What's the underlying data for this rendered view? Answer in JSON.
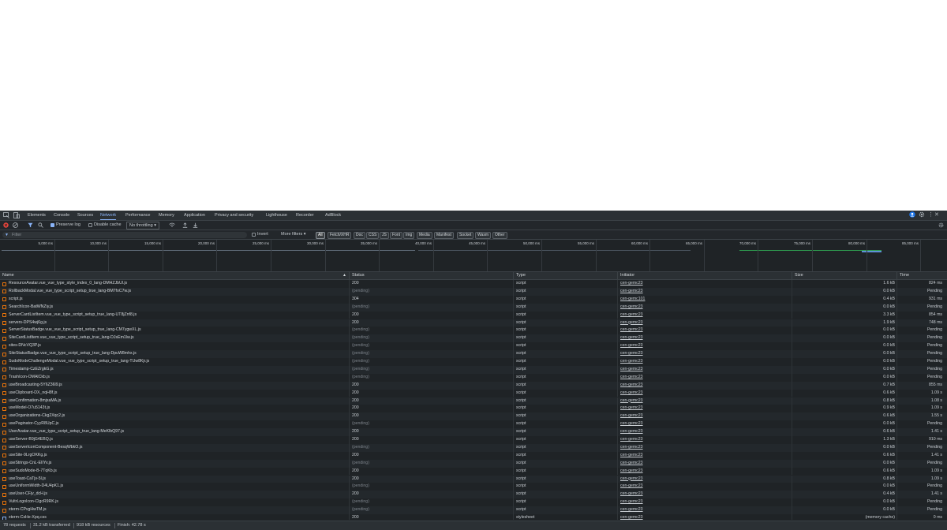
{
  "devtools": {
    "tabs": [
      "Elements",
      "Console",
      "Sources",
      "Network",
      "Performance",
      "Memory",
      "Application",
      "Privacy and security",
      "Lighthouse",
      "Recorder",
      "AdBlock"
    ],
    "active_tab": "Network",
    "right_icons": [
      "profile-icon",
      "gear-icon",
      "more-vert-icon",
      "close-icon"
    ]
  },
  "toolbar": {
    "preserve_log_label": "Preserve log",
    "preserve_log_checked": true,
    "disable_cache_label": "Disable cache",
    "disable_cache_checked": false,
    "throttling_value": "No throttling"
  },
  "filterbar": {
    "filter_placeholder": "Filter",
    "invert_label": "Invert",
    "more_filters_label": "More filters ▾",
    "chips": [
      "All",
      "Fetch/XHR",
      "Doc",
      "CSS",
      "JS",
      "Font",
      "Img",
      "Media",
      "Manifest",
      "Socket",
      "Wasm",
      "Other"
    ],
    "active_chip": "All"
  },
  "overview": {
    "ticks": [
      "5,000 ms",
      "10,000 ms",
      "15,000 ms",
      "20,000 ms",
      "25,000 ms",
      "30,000 ms",
      "35,000 ms",
      "40,000 ms",
      "45,000 ms",
      "50,000 ms",
      "55,000 ms",
      "60,000 ms",
      "65,000 ms",
      "70,000 ms",
      "75,000 ms",
      "80,000 ms",
      "85,000 ms"
    ]
  },
  "table": {
    "columns": {
      "name": "Name",
      "status": "Status",
      "type": "Type",
      "initiator": "Initiator",
      "size": "Size",
      "time": "Time"
    },
    "rows": [
      {
        "name": "ResourceAvatar.vue_vue_type_style_index_0_lang-DMHZJbUl.js",
        "status": "200",
        "type": "script",
        "initiator": "cen-gemc23",
        "size": "1.6 kB",
        "time": "824 ms",
        "kind": "js"
      },
      {
        "name": "RollbackModal.vue_vue_type_script_setup_true_lang-BM7foC7w.js",
        "status": "(pending)",
        "type": "script",
        "initiator": "cen-gemc23",
        "size": "0.0 kB",
        "time": "Pending",
        "kind": "js"
      },
      {
        "name": "script.js",
        "status": "304",
        "type": "script",
        "initiator": "cen-gemc101",
        "size": "0.4 kB",
        "time": "931 ms",
        "kind": "js"
      },
      {
        "name": "SearchIcon-BatWNZiy.js",
        "status": "(pending)",
        "type": "script",
        "initiator": "cen-gemc23",
        "size": "0.0 kB",
        "time": "Pending",
        "kind": "js"
      },
      {
        "name": "ServerCardListItem.vue_vue_type_script_setup_true_lang-UT8jZnf8.js",
        "status": "200",
        "type": "script",
        "initiator": "cen-gemc23",
        "size": "3.3 kB",
        "time": "854 ms",
        "kind": "js"
      },
      {
        "name": "servers-DPS4wj6g.js",
        "status": "200",
        "type": "script",
        "initiator": "cen-gemc23",
        "size": "1.9 kB",
        "time": "748 ms",
        "kind": "js"
      },
      {
        "name": "ServerStatusBadge.vue_vue_type_script_setup_true_lang-CM7ygwXL.js",
        "status": "(pending)",
        "type": "script",
        "initiator": "cen-gemc23",
        "size": "0.0 kB",
        "time": "Pending",
        "kind": "js"
      },
      {
        "name": "SiteCardListItem.vue_vue_type_script_setup_true_lang-DJsEm1lw.js",
        "status": "(pending)",
        "type": "script",
        "initiator": "cen-gemc23",
        "size": "0.0 kB",
        "time": "Pending",
        "kind": "js"
      },
      {
        "name": "sites-DNcVQ3P.js",
        "status": "(pending)",
        "type": "script",
        "initiator": "cen-gemc23",
        "size": "0.0 kB",
        "time": "Pending",
        "kind": "js"
      },
      {
        "name": "SiteStatusBadge.vue_vue_type_script_setup_true_lang-DpuW8mhx.js",
        "status": "(pending)",
        "type": "script",
        "initiator": "cen-gemc23",
        "size": "0.0 kB",
        "time": "Pending",
        "kind": "js"
      },
      {
        "name": "SudoModeChallengeModal.vue_vue_type_script_setup_true_lang-TUw8Kjr.js",
        "status": "(pending)",
        "type": "script",
        "initiator": "cen-gemc23",
        "size": "0.0 kB",
        "time": "Pending",
        "kind": "js"
      },
      {
        "name": "Timestamp-CzEZrgkG.js",
        "status": "(pending)",
        "type": "script",
        "initiator": "cen-gemc23",
        "size": "0.0 kB",
        "time": "Pending",
        "kind": "js"
      },
      {
        "name": "TrashIcon-OMAlCkb.js",
        "status": "(pending)",
        "type": "script",
        "initiator": "cen-gemc23",
        "size": "0.0 kB",
        "time": "Pending",
        "kind": "js"
      },
      {
        "name": "useBroadcasting-5Y6Z36l9.js",
        "status": "200",
        "type": "script",
        "initiator": "cen-gemc23",
        "size": "0.7 kB",
        "time": "855 ms",
        "kind": "js"
      },
      {
        "name": "useClipboard-DX_nqH8f.js",
        "status": "200",
        "type": "script",
        "initiator": "cen-gemc23",
        "size": "0.6 kB",
        "time": "1.09 s",
        "kind": "js"
      },
      {
        "name": "useConfirmation-8mjxaMA.js",
        "status": "200",
        "type": "script",
        "initiator": "cen-gemc23",
        "size": "0.8 kB",
        "time": "1.08 s",
        "kind": "js"
      },
      {
        "name": "useModel-O7u5143t.js",
        "status": "200",
        "type": "script",
        "initiator": "cen-gemc23",
        "size": "0.9 kB",
        "time": "1.09 s",
        "kind": "js"
      },
      {
        "name": "useOrganizations-Ckg2Xqc2.js",
        "status": "200",
        "type": "script",
        "initiator": "cen-gemc23",
        "size": "0.6 kB",
        "time": "1.55 s",
        "kind": "js"
      },
      {
        "name": "usePaginator-CyyR8UpC.js",
        "status": "(pending)",
        "type": "script",
        "initiator": "cen-gemc23",
        "size": "0.0 kB",
        "time": "Pending",
        "kind": "js"
      },
      {
        "name": "UserAvatar.vue_vue_type_script_setup_true_lang-MeKlbQ97.js",
        "status": "200",
        "type": "script",
        "initiator": "cen-gemc23",
        "size": "0.6 kB",
        "time": "1.41 s",
        "kind": "js"
      },
      {
        "name": "useServer-B9jG4EBQ.js",
        "status": "200",
        "type": "script",
        "initiator": "cen-gemc23",
        "size": "1.3 kB",
        "time": "910 ms",
        "kind": "js"
      },
      {
        "name": "useServerIconComponent-BesqWbkO.js",
        "status": "(pending)",
        "type": "script",
        "initiator": "cen-gemc23",
        "size": "0.0 kB",
        "time": "Pending",
        "kind": "js"
      },
      {
        "name": "useSite-9LrgOKKg.js",
        "status": "200",
        "type": "script",
        "initiator": "cen-gemc23",
        "size": "0.6 kB",
        "time": "1.41 s",
        "kind": "js"
      },
      {
        "name": "useStrings-CnL-EIIYv.js",
        "status": "(pending)",
        "type": "script",
        "initiator": "cen-gemc23",
        "size": "0.0 kB",
        "time": "Pending",
        "kind": "js"
      },
      {
        "name": "useSudoMode-B-7TqKb.js",
        "status": "200",
        "type": "script",
        "initiator": "cen-gemc23",
        "size": "0.6 kB",
        "time": "1.09 s",
        "kind": "js"
      },
      {
        "name": "useToast-CaTjv-5l.js",
        "status": "200",
        "type": "script",
        "initiator": "cen-gemc23",
        "size": "0.8 kB",
        "time": "1.09 s",
        "kind": "js"
      },
      {
        "name": "useUniformWidth-D4U4pK1.js",
        "status": "(pending)",
        "type": "script",
        "initiator": "cen-gemc23",
        "size": "0.0 kB",
        "time": "Pending",
        "kind": "js"
      },
      {
        "name": "useUser-CFjv_dcH.js",
        "status": "200",
        "type": "script",
        "initiator": "cen-gemc23",
        "size": "0.4 kB",
        "time": "1.41 s",
        "kind": "js"
      },
      {
        "name": "VultrLogoIcon-ClgcR9RK.js",
        "status": "(pending)",
        "type": "script",
        "initiator": "cen-gemc23",
        "size": "0.0 kB",
        "time": "Pending",
        "kind": "js"
      },
      {
        "name": "xterm-CPvgHwTM.js",
        "status": "(pending)",
        "type": "script",
        "initiator": "cen-gemc23",
        "size": "0.0 kB",
        "time": "Pending",
        "kind": "js"
      },
      {
        "name": "xterm-CsHe-Xpq.css",
        "status": "200",
        "type": "stylesheet",
        "initiator": "cen-gemc23",
        "size": "(memory cache)",
        "time": "0 ms",
        "kind": "css"
      }
    ]
  },
  "statusbar": {
    "requests": "78 requests",
    "transferred": "31.2 kB transferred",
    "resources": "918 kB resources",
    "finish": "Finish: 42.78 s"
  },
  "colors": {
    "panel_bg": "#1f2326",
    "accent": "#8ab4f8",
    "js_icon": "#e8730a",
    "css_icon": "#8ab4f8",
    "pending": "#7c838a"
  }
}
